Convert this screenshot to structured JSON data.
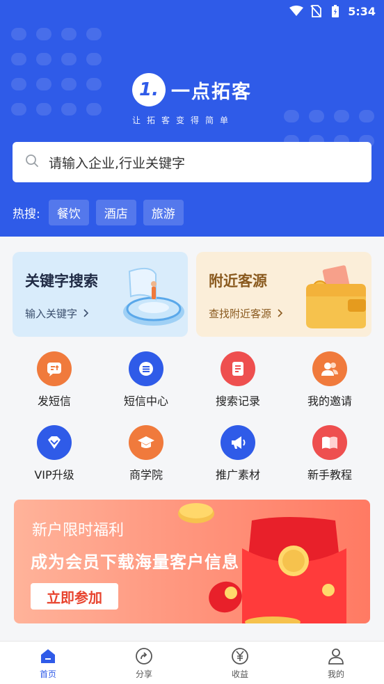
{
  "status_bar": {
    "time": "5:34"
  },
  "brand": {
    "logo_mark": "1.",
    "name": "一点拓客",
    "slogan": "让拓客变得简单"
  },
  "search": {
    "placeholder": "请输入企业,行业关键字"
  },
  "hot_search": {
    "label": "热搜:",
    "tags": [
      "餐饮",
      "酒店",
      "旅游"
    ]
  },
  "cards": [
    {
      "title": "关键字搜索",
      "subtitle": "输入关键字"
    },
    {
      "title": "附近客源",
      "subtitle": "查找附近客源"
    }
  ],
  "grid": [
    {
      "label": "发短信",
      "icon": "send-sms-icon",
      "color": "#f07a3c"
    },
    {
      "label": "短信中心",
      "icon": "sms-center-icon",
      "color": "#2f5be8"
    },
    {
      "label": "搜索记录",
      "icon": "search-record-icon",
      "color": "#ee4f4f"
    },
    {
      "label": "我的邀请",
      "icon": "invite-icon",
      "color": "#f07a3c"
    },
    {
      "label": "VIP升级",
      "icon": "vip-diamond-icon",
      "color": "#2f5be8"
    },
    {
      "label": "商学院",
      "icon": "graduation-cap-icon",
      "color": "#f07a3c"
    },
    {
      "label": "推广素材",
      "icon": "megaphone-icon",
      "color": "#2f5be8"
    },
    {
      "label": "新手教程",
      "icon": "book-icon",
      "color": "#ee4f4f"
    }
  ],
  "banner": {
    "line1": "新户限时福利",
    "line2": "成为会员下载海量客户信息",
    "button": "立即参加"
  },
  "tabs": [
    {
      "label": "首页",
      "icon": "home-icon",
      "active": true
    },
    {
      "label": "分享",
      "icon": "share-icon",
      "active": false
    },
    {
      "label": "收益",
      "icon": "yuan-icon",
      "active": false
    },
    {
      "label": "我的",
      "icon": "user-icon",
      "active": false
    }
  ],
  "colors": {
    "primary": "#2f5be8",
    "orange": "#f07a3c",
    "red": "#ee4f4f"
  }
}
